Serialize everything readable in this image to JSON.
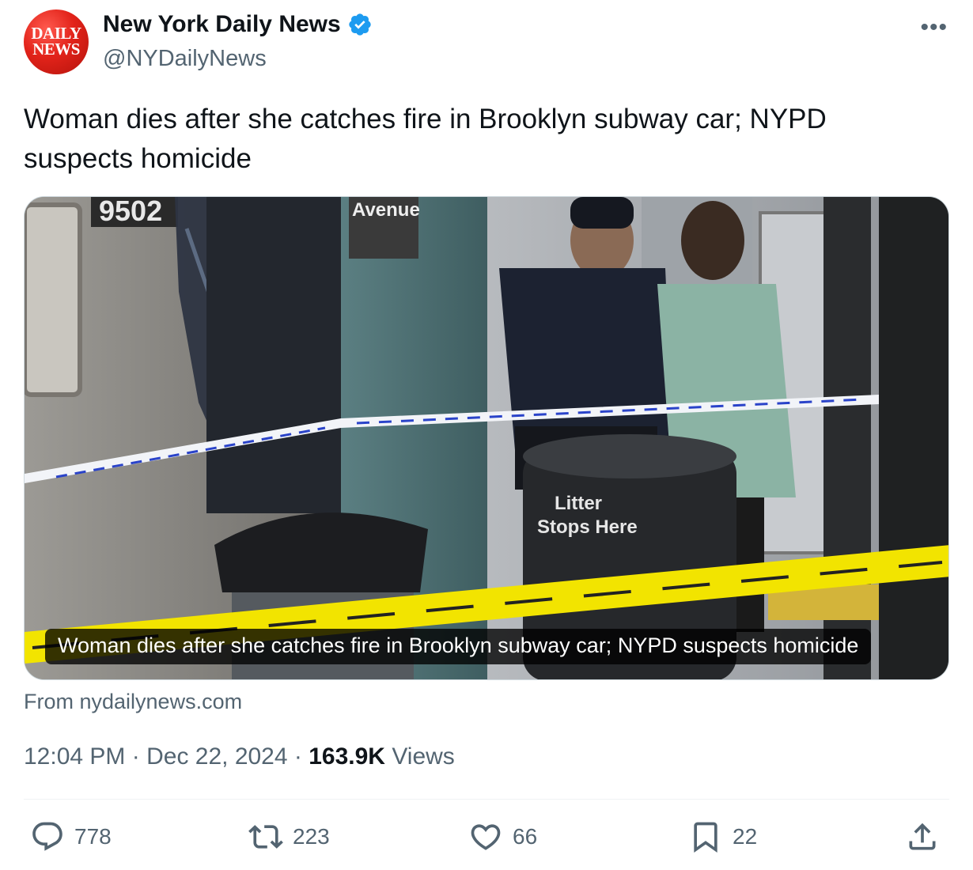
{
  "author": {
    "avatar_line1": "DAILY",
    "avatar_line2": "NEWS",
    "display_name": "New York Daily News",
    "handle": "@NYDailyNews",
    "verified": true
  },
  "more_label": "•••",
  "tweet_text": "Woman dies after she catches fire in Brooklyn subway car; NYPD suspects homicide",
  "media": {
    "caption": "Woman dies after she catches fire in Brooklyn subway car; NYPD suspects homicide",
    "sign_text": "Avenue",
    "car_number": "9502",
    "trash_label_line1": "Litter",
    "trash_label_line2": "Stops Here"
  },
  "source": "From nydailynews.com",
  "meta": {
    "time": "12:04 PM",
    "sep1": " · ",
    "date": "Dec 22, 2024",
    "sep2": " · ",
    "views_count": "163.9K",
    "views_label": " Views"
  },
  "actions": {
    "replies": "778",
    "reposts": "223",
    "likes": "66",
    "bookmarks": "22"
  },
  "colors": {
    "brand_red": "#e2231a",
    "verified_blue": "#1d9bf0",
    "muted": "#536471"
  }
}
